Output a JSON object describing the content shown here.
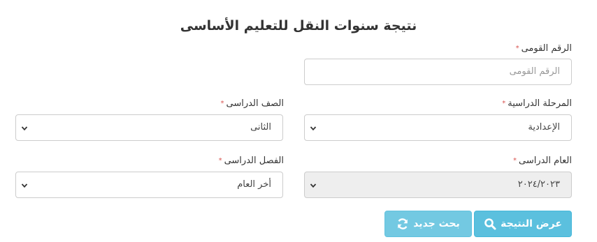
{
  "page": {
    "title": "نتيجة سنوات النقل للتعليم الأساسى"
  },
  "form": {
    "national_id": {
      "label": "الرقم القومى",
      "placeholder": "الرقم القومى"
    },
    "stage": {
      "label": "المرحلة الدراسية",
      "value": "الإعدادية"
    },
    "grade": {
      "label": "الصف الدراسى",
      "value": "الثانى"
    },
    "year": {
      "label": "العام الدراسى",
      "value": "٢٠٢٤/٢٠٢٣"
    },
    "term": {
      "label": "الفصل الدراسى",
      "value": "أخر العام"
    },
    "required_mark": "*"
  },
  "buttons": {
    "show_result": {
      "label": "عرض النتيجة",
      "icon": "search-icon"
    },
    "new_search": {
      "label": "بحث جديد",
      "icon": "refresh-icon"
    }
  },
  "colors": {
    "button_bg": "#5bc0de",
    "required": "#d9534f",
    "disabled_bg": "#eeeeee"
  }
}
